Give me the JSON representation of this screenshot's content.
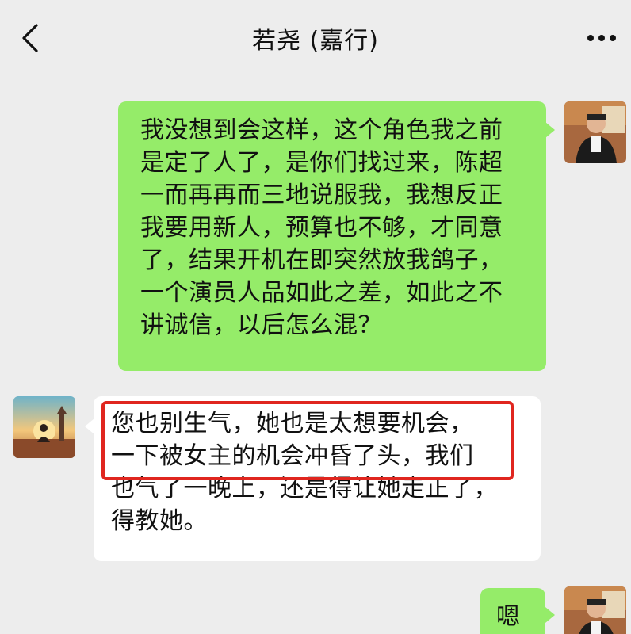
{
  "header": {
    "title": "若尧 (嘉行)",
    "back_icon": "chevron-left-icon",
    "more_icon": "more-dots-icon"
  },
  "messages": [
    {
      "side": "right",
      "bubble_color": "#95ec69",
      "lines": [
        "我没想到会这样，这个角色我之前",
        "是定了人了，是你们找过来，陈超",
        "一而再再而三地说服我，我想反正",
        "我要用新人，预算也不够，才同意",
        "了，结果开机在即突然放我鸽子，",
        "一个演员人品如此之差，如此之不",
        "讲诚信，以后怎么混？"
      ]
    },
    {
      "side": "left",
      "bubble_color": "#ffffff",
      "highlight_color": "#e0261f",
      "lines": [
        "您也别生气，她也是太想要机会，",
        "一下被女主的机会冲昏了头，我们",
        "也气了一晚上，还是得让她走正了，",
        "得教她。"
      ]
    },
    {
      "side": "right",
      "bubble_color": "#95ec69",
      "lines": [
        "嗯"
      ]
    }
  ]
}
